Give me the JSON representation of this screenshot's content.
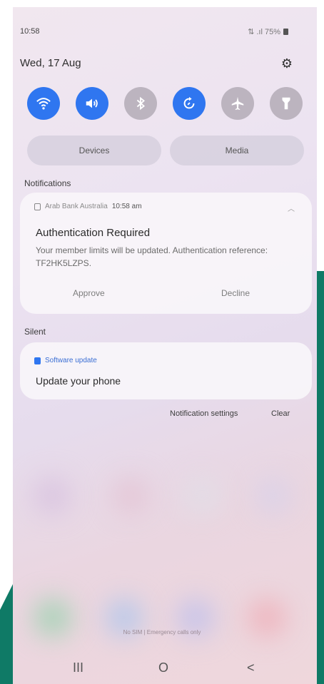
{
  "status_bar": {
    "time": "10:58",
    "indicators": "⇅ .ıl 75%"
  },
  "header": {
    "date": "Wed, 17 Aug",
    "settings_icon": "gear-icon"
  },
  "quick_settings": [
    {
      "name": "wifi",
      "icon": "wifi-icon",
      "state": "on"
    },
    {
      "name": "sound",
      "icon": "volume-icon",
      "state": "on"
    },
    {
      "name": "bluetooth",
      "icon": "bluetooth-icon",
      "state": "off"
    },
    {
      "name": "auto-rotate",
      "icon": "rotate-icon",
      "state": "on"
    },
    {
      "name": "airplane",
      "icon": "airplane-icon",
      "state": "off"
    },
    {
      "name": "flashlight",
      "icon": "flashlight-icon",
      "state": "off"
    }
  ],
  "panels": {
    "devices_label": "Devices",
    "media_label": "Media"
  },
  "notifications_label": "Notifications",
  "notification": {
    "app_name": "Arab Bank Australia",
    "time": "10:58 am",
    "title": "Authentication Required",
    "body": "Your member limits will be updated. Authentication reference: TF2HK5LZPS.",
    "approve_label": "Approve",
    "decline_label": "Decline"
  },
  "silent_label": "Silent",
  "silent_notification": {
    "app_name": "Software update",
    "title": "Update your phone"
  },
  "footer": {
    "settings_label": "Notification settings",
    "clear_label": "Clear"
  },
  "emergency_text": "No SIM | Emergency calls only",
  "nav": {
    "recents": "III",
    "home": "O",
    "back": "<"
  },
  "colors": {
    "accent": "#2f76f0",
    "toggle_off": "#bcb4bf",
    "brand_teal": "#0f7a66"
  }
}
